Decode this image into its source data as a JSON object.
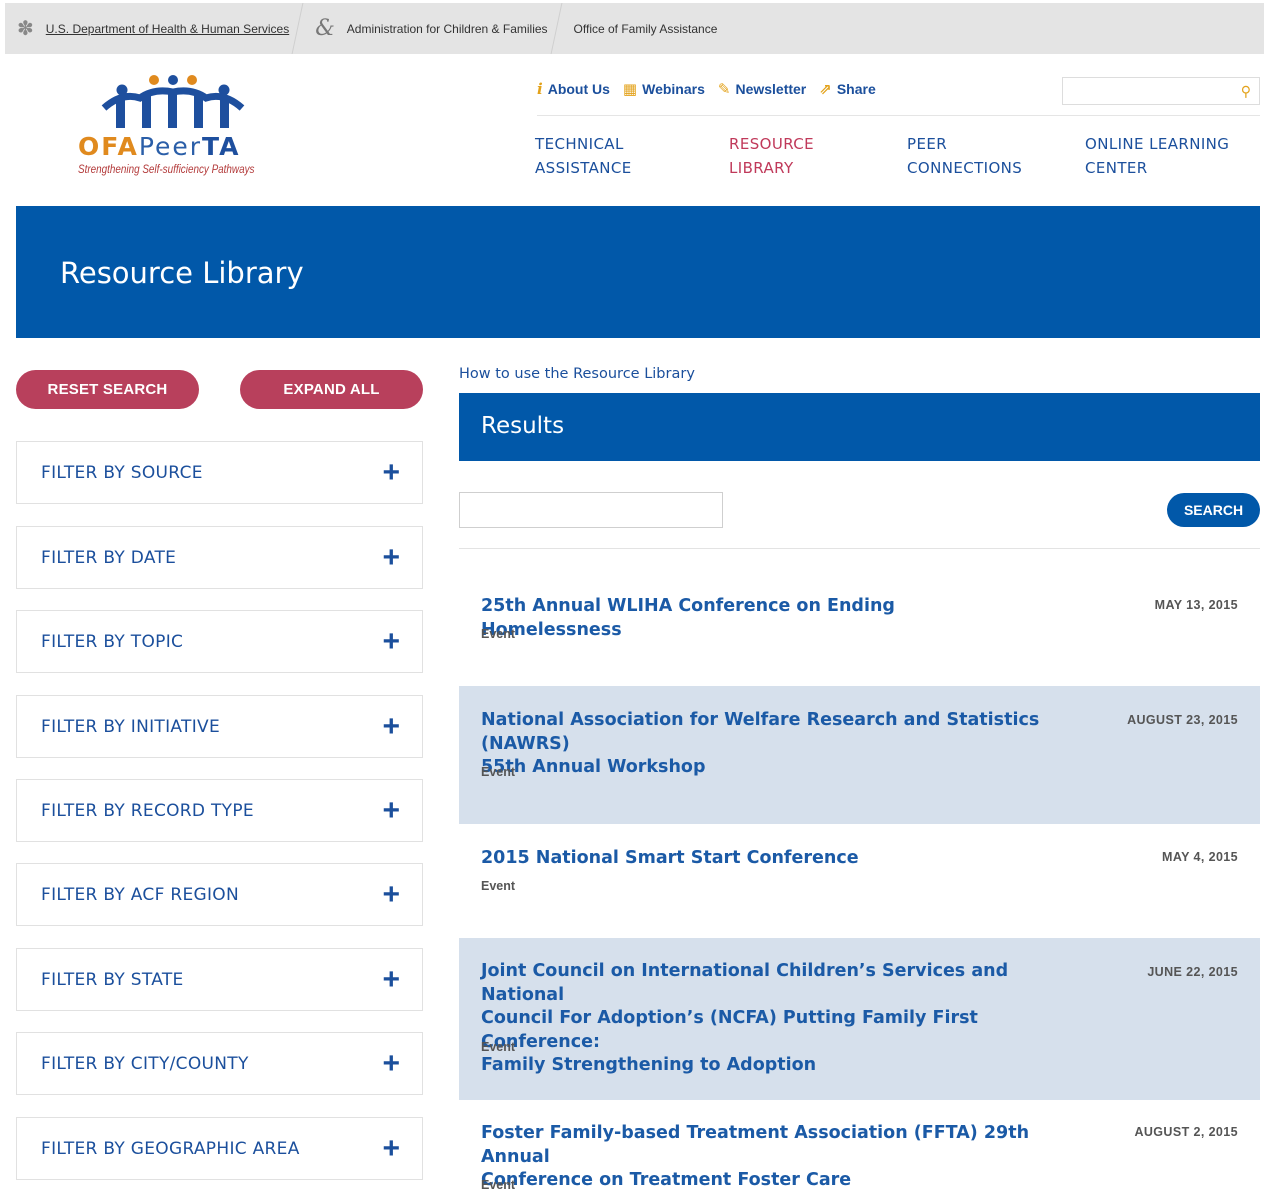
{
  "gov_bar": {
    "hhs": "U.S. Department of Health & Human Services",
    "acf": "Administration for Children & Families",
    "ofa": "Office of Family Assistance"
  },
  "logo": {
    "ofa": "OFA",
    "peer": "Peer",
    "ta": "TA",
    "tagline": "Strengthening Self-sufficiency Pathways"
  },
  "utility": {
    "about": "About Us",
    "webinars": "Webinars",
    "newsletter": "Newsletter",
    "share": "Share",
    "search_placeholder": ""
  },
  "nav": {
    "technical_1": "TECHNICAL",
    "technical_2": "ASSISTANCE",
    "resource_1": "RESOURCE",
    "resource_2": "LIBRARY",
    "peer_1": "PEER",
    "peer_2": "CONNECTIONS",
    "online_1": "ONLINE LEARNING",
    "online_2": "CENTER"
  },
  "hero": {
    "title": "Resource Library"
  },
  "sidebar": {
    "reset": "RESET SEARCH",
    "expand": "EXPAND ALL",
    "filters": [
      "FILTER BY SOURCE",
      "FILTER BY DATE",
      "FILTER BY TOPIC",
      "FILTER BY INITIATIVE",
      "FILTER BY RECORD TYPE",
      "FILTER BY ACF REGION",
      "FILTER BY STATE",
      "FILTER BY CITY/COUNTY",
      "FILTER BY GEOGRAPHIC AREA"
    ]
  },
  "main": {
    "howto": "How to use the Resource Library",
    "results_title": "Results",
    "search_value": "",
    "search_button": "SEARCH",
    "results": [
      {
        "title_1": "25th Annual WLIHA Conference on Ending Homelessness",
        "title_2": "",
        "title_3": "",
        "date": "MAY 13, 2015",
        "type": "Event"
      },
      {
        "title_1": "National Association for Welfare Research and Statistics (NAWRS)",
        "title_2": "55th Annual Workshop",
        "title_3": "",
        "date": "AUGUST 23, 2015",
        "type": "Event"
      },
      {
        "title_1": "2015 National Smart Start Conference",
        "title_2": "",
        "title_3": "",
        "date": "MAY 4, 2015",
        "type": "Event"
      },
      {
        "title_1": "Joint Council on International Children’s Services and National",
        "title_2": "Council For Adoption’s (NCFA) Putting Family First Conference:",
        "title_3": "Family Strengthening to Adoption",
        "date": "JUNE 22, 2015",
        "type": "Event"
      },
      {
        "title_1": "Foster Family-based Treatment Association (FFTA) 29th Annual",
        "title_2": "Conference on Treatment Foster Care",
        "title_3": "",
        "date": "AUGUST 2, 2015",
        "type": "Event"
      }
    ]
  },
  "colors": {
    "brand_blue": "#0158a9",
    "link_blue": "#1b4f9c",
    "accent_pink": "#b8405c",
    "shaded_row": "#d6e0ec",
    "logo_orange": "#e08a1e"
  }
}
